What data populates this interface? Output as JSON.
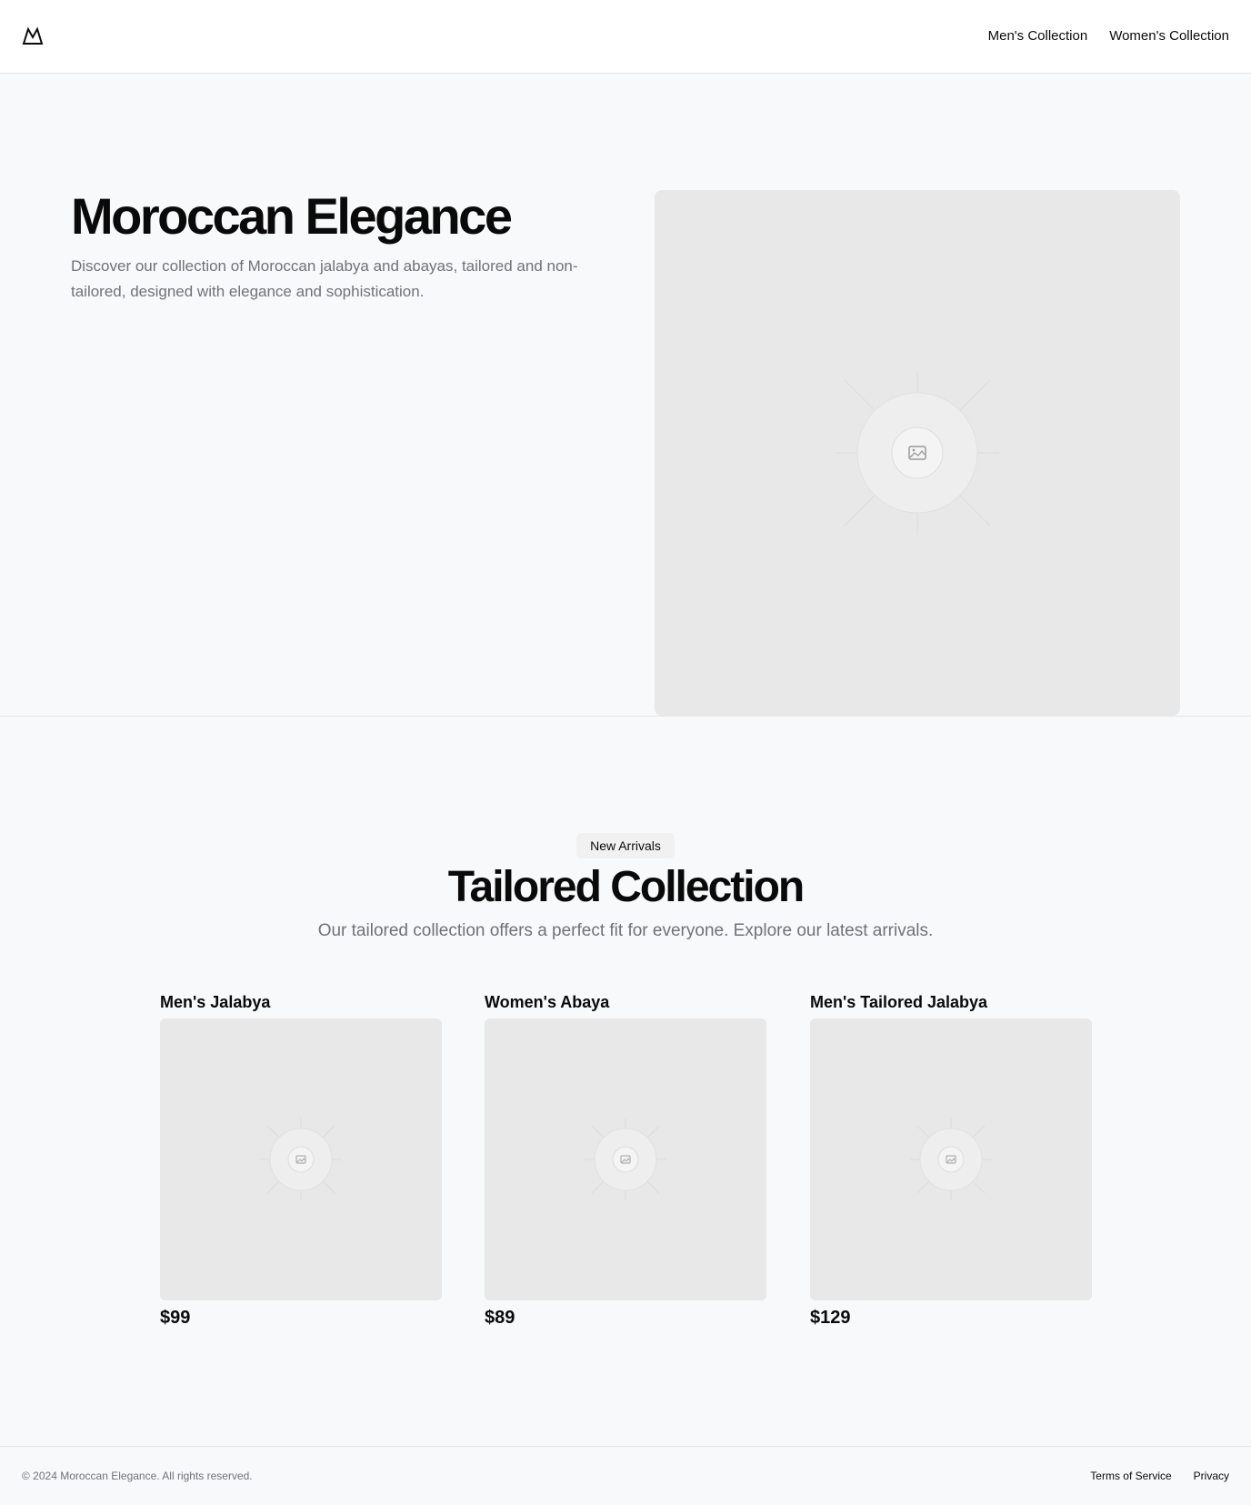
{
  "header": {
    "logo_icon": "mountain-logo-icon",
    "nav": [
      {
        "label": "Men's Collection"
      },
      {
        "label": "Women's Collection"
      }
    ]
  },
  "hero": {
    "title": "Moroccan Elegance",
    "description": "Discover our collection of Moroccan jalabya and abayas, tailored and non-tailored, designed with elegance and sophistication.",
    "image_icon": "image-placeholder-icon"
  },
  "collection": {
    "badge": "New Arrivals",
    "title": "Tailored Collection",
    "subtitle": "Our tailored collection offers a perfect fit for everyone. Explore our latest arrivals.",
    "products": [
      {
        "name": "Men's Jalabya",
        "price": "$99"
      },
      {
        "name": "Women's Abaya",
        "price": "$89"
      },
      {
        "name": "Men's Tailored Jalabya",
        "price": "$129"
      }
    ]
  },
  "footer": {
    "copyright": "© 2024 Moroccan Elegance. All rights reserved.",
    "links": [
      {
        "label": "Terms of Service"
      },
      {
        "label": "Privacy"
      }
    ]
  }
}
